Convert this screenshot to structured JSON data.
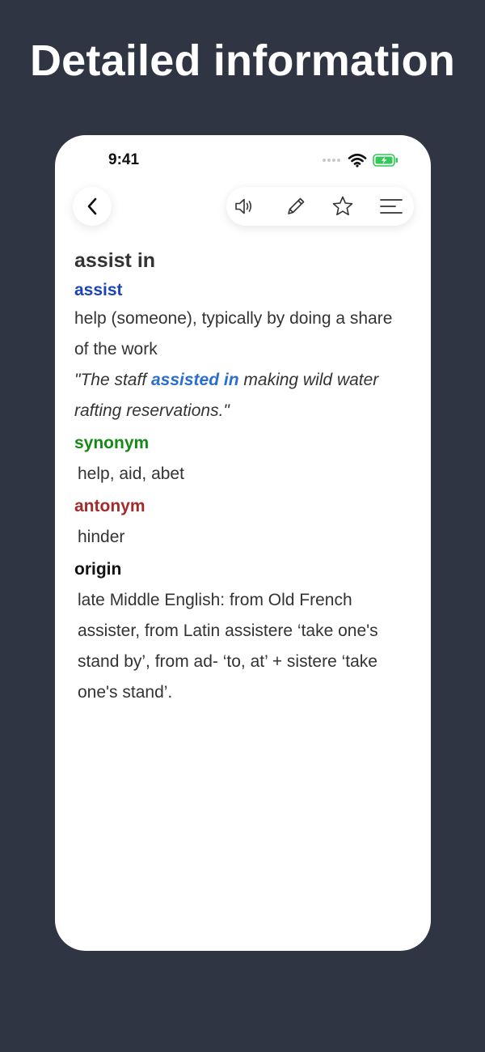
{
  "banner": {
    "title": "Detailed information"
  },
  "status_bar": {
    "time": "9:41"
  },
  "toolbar": {
    "icons": [
      "chevron-left-icon",
      "speaker-icon",
      "pencil-icon",
      "star-icon",
      "menu-icon"
    ]
  },
  "entry": {
    "term": "assist in",
    "headword": "assist",
    "definition": "help (someone), typically by doing a share of the work",
    "example": {
      "open_quote": "\"The staff ",
      "highlight": "assisted in",
      "rest": " making wild water rafting reservations.\""
    },
    "synonym_label": "synonym",
    "synonyms": "help, aid, abet",
    "antonym_label": "antonym",
    "antonyms": "hinder",
    "origin_label": "origin",
    "origin_text": "late Middle English: from Old French assister, from Latin assistere ‘take one's stand by’, from ad- ‘to, at’ + sistere ‘take one's stand’."
  },
  "colors": {
    "background": "#2f3542",
    "headword": "#1a44b8",
    "example_highlight": "#2a6fd0",
    "synonym": "#168a16",
    "antonym": "#a52a2a",
    "battery": "#34c759"
  }
}
